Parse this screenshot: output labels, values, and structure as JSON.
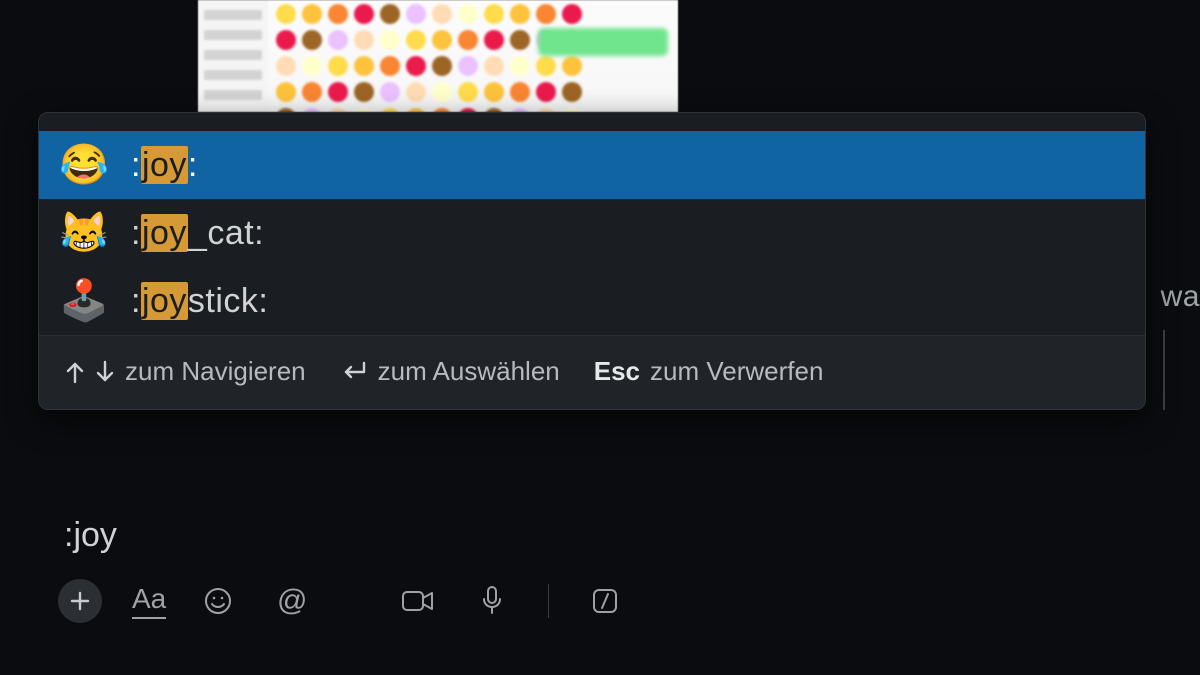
{
  "background": {
    "clipped_text_right": "wa"
  },
  "suggest": {
    "query": "joy",
    "items": [
      {
        "emoji": "😂",
        "prefix": ":",
        "match": "joy",
        "suffix": ":",
        "selected": true
      },
      {
        "emoji": "😹",
        "prefix": ":",
        "match": "joy",
        "suffix": "_cat:",
        "selected": false
      },
      {
        "emoji": "🕹️",
        "prefix": ":",
        "match": "joy",
        "suffix": "stick:",
        "selected": false
      }
    ],
    "footer": {
      "navigate": "zum Navigieren",
      "select": "zum Auswählen",
      "dismiss_key": "Esc",
      "dismiss": "zum Verwerfen"
    }
  },
  "composer": {
    "text": ":joy",
    "toolbar": {
      "plus": "+",
      "format_text": "Aa",
      "emoji": "emoji-icon",
      "mention": "@",
      "video": "video-icon",
      "audio": "mic-icon",
      "shortcuts": "shortcuts-icon"
    }
  }
}
